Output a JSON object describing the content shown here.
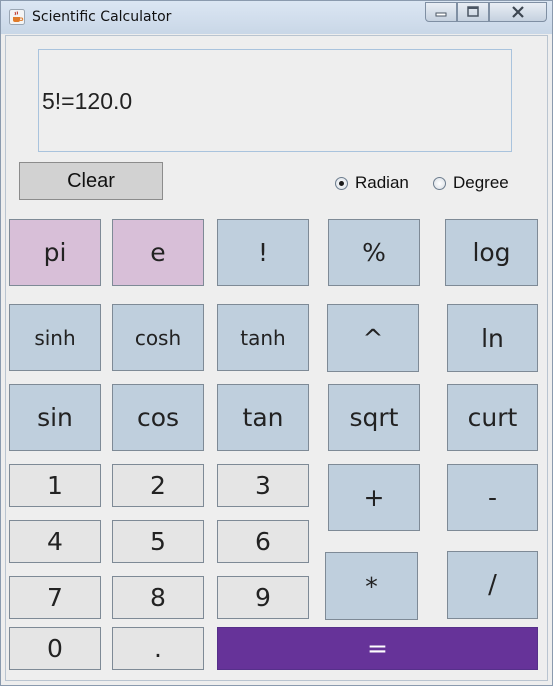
{
  "window": {
    "title": "Scientific Calculator"
  },
  "display": {
    "text": "5!=120.0"
  },
  "controls": {
    "clear_label": "Clear",
    "mode": {
      "options": [
        "Radian",
        "Degree"
      ],
      "selected": "Radian"
    }
  },
  "keys": {
    "pi": "pi",
    "e": "e",
    "fact": "!",
    "percent": "%",
    "log": "log",
    "sinh": "sinh",
    "cosh": "cosh",
    "tanh": "tanh",
    "pow": "^",
    "ln": "ln",
    "sin": "sin",
    "cos": "cos",
    "tan": "tan",
    "sqrt": "sqrt",
    "curt": "curt",
    "d1": "1",
    "d2": "2",
    "d3": "3",
    "plus": "+",
    "minus": "-",
    "d4": "4",
    "d5": "5",
    "d6": "6",
    "mul": "*",
    "div": "/",
    "d7": "7",
    "d8": "8",
    "d9": "9",
    "d0": "0",
    "dot": ".",
    "equals": "="
  },
  "colors": {
    "function_key": "#bfcfdd",
    "constant_key": "#d8bfd8",
    "digit_key": "#e5e5e5",
    "equals_key": "#663399"
  },
  "icons": {
    "app": "java-cup-icon",
    "minimize": "minimize-icon",
    "maximize": "maximize-icon",
    "close": "close-icon"
  }
}
